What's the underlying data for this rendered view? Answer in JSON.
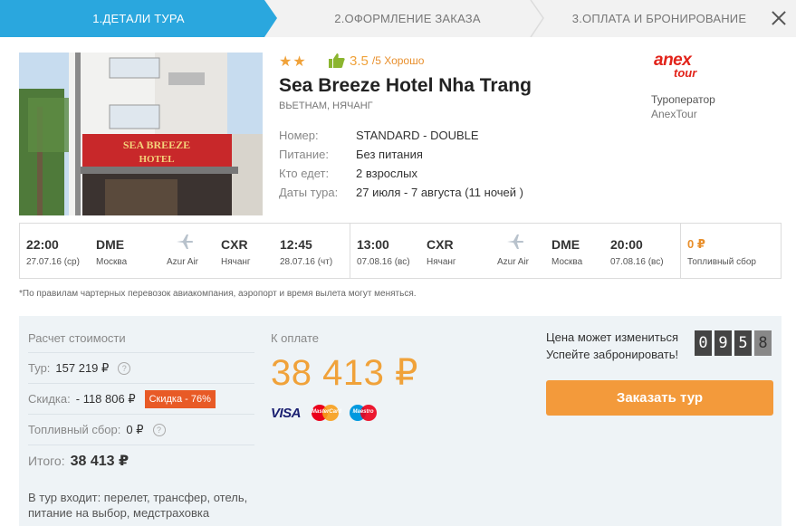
{
  "steps": [
    {
      "label": "1.Детали тура"
    },
    {
      "label": "2.Оформление заказа"
    },
    {
      "label": "3.Оплата и бронирование"
    }
  ],
  "hotel": {
    "stars": "★★",
    "rating": "3.5",
    "rating_max": "/5 Хорошо",
    "name": "Sea Breeze Hotel Nha Trang",
    "location": "Вьетнам, Нячанг",
    "details": [
      {
        "label": "Номер:",
        "value": "STANDARD - DOUBLE"
      },
      {
        "label": "Питание:",
        "value": "Без питания"
      },
      {
        "label": "Кто едет:",
        "value": "2 взрослых"
      },
      {
        "label": "Даты тура:",
        "value": "27 июля - 7 августа (11 ночей )"
      }
    ],
    "photo_sign_line1": "SEA BREEZE",
    "photo_sign_line2": "HOTEL"
  },
  "operator": {
    "logo_text_1": "anex",
    "logo_text_2": "tour",
    "title": "Туроператор",
    "name": "AnexTour",
    "brand_color": "#e2231a"
  },
  "flights": {
    "outbound": {
      "dep_time": "22:00",
      "dep_date": "27.07.16 (ср)",
      "dep_code": "DME",
      "dep_city": "Москва",
      "airline": "Azur Air",
      "arr_code": "CXR",
      "arr_city": "Нячанг",
      "arr_time": "12:45",
      "arr_date": "28.07.16 (чт)"
    },
    "inbound": {
      "dep_time": "13:00",
      "dep_date": "07.08.16 (вс)",
      "dep_code": "CXR",
      "dep_city": "Нячанг",
      "airline": "Azur Air",
      "arr_code": "DME",
      "arr_city": "Москва",
      "arr_time": "20:00",
      "arr_date": "07.08.16 (вс)"
    },
    "fuel_value": "0 ₽",
    "fuel_label": "Топливный сбор",
    "icon": "plane-icon"
  },
  "note": "*По правилам чартерных перевозок авиакомпания, аэропорт и время вылета могут меняться.",
  "calc": {
    "title": "Расчет стоимости",
    "tour_label": "Тур:",
    "tour_value": "157 219 ₽",
    "discount_label": "Скидка:",
    "discount_value": "- 118 806 ₽",
    "discount_badge": "Скидка - 76%",
    "fuel_label": "Топливный сбор:",
    "fuel_value": "0 ₽",
    "total_label": "Итого:",
    "total_value": "38 413 ₽",
    "includes": "В тур входит: перелет, трансфер, отель, питание на выбор, медстраховка"
  },
  "payment": {
    "title": "К оплате",
    "amount": "38 413 ₽",
    "cards": [
      "VISA",
      "MasterCard",
      "Maestro"
    ],
    "accent_color": "#f0a23a"
  },
  "timer": {
    "line1": "Цена может измениться",
    "line2": "Успейте забронировать!",
    "digits": [
      "0",
      "9",
      "5",
      "8"
    ]
  },
  "book_button": "Заказать тур"
}
